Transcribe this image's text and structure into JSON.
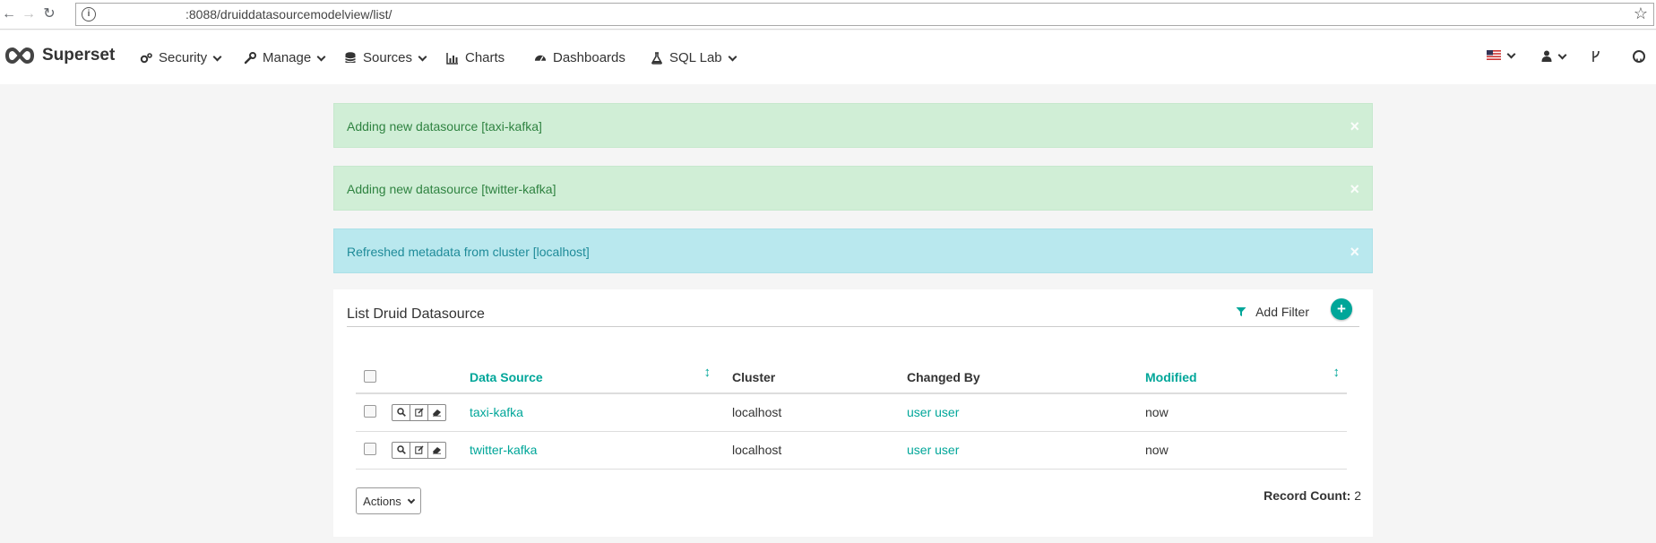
{
  "browser": {
    "url": ":8088/druiddatasourcemodelview/list/"
  },
  "navbar": {
    "brand": "Superset",
    "items": [
      {
        "label": "Security",
        "icon": "gears-icon"
      },
      {
        "label": "Manage",
        "icon": "wrench-icon"
      },
      {
        "label": "Sources",
        "icon": "database-icon"
      },
      {
        "label": "Charts",
        "icon": "bar-chart-icon"
      },
      {
        "label": "Dashboards",
        "icon": "dashboard-icon"
      },
      {
        "label": "SQL Lab",
        "icon": "flask-icon"
      }
    ],
    "right_icons": [
      "us-flag-icon",
      "user-icon",
      "git-branch-icon",
      "github-icon"
    ]
  },
  "alerts": [
    {
      "type": "success",
      "text": "Adding new datasource [taxi-kafka]",
      "close": "×"
    },
    {
      "type": "success",
      "text": "Adding new datasource [twitter-kafka]",
      "close": "×"
    },
    {
      "type": "info",
      "text": "Refreshed metadata from cluster [localhost]",
      "close": "×"
    }
  ],
  "panel": {
    "title": "List Druid Datasource",
    "add_filter": "Add Filter",
    "add_button": "+"
  },
  "table": {
    "columns": [
      "Data Source",
      "Cluster",
      "Changed By",
      "Modified"
    ],
    "rows": [
      {
        "datasource": "taxi-kafka",
        "cluster": "localhost",
        "changed_by": "user user",
        "modified": "now"
      },
      {
        "datasource": "twitter-kafka",
        "cluster": "localhost",
        "changed_by": "user user",
        "modified": "now"
      }
    ]
  },
  "footer": {
    "actions_label": "Actions",
    "record_count_label": "Record Count:",
    "record_count_value": "2"
  },
  "colors": {
    "accent": "#00a699",
    "success_bg": "#d0eed6",
    "info_bg": "#b9e8ee"
  }
}
